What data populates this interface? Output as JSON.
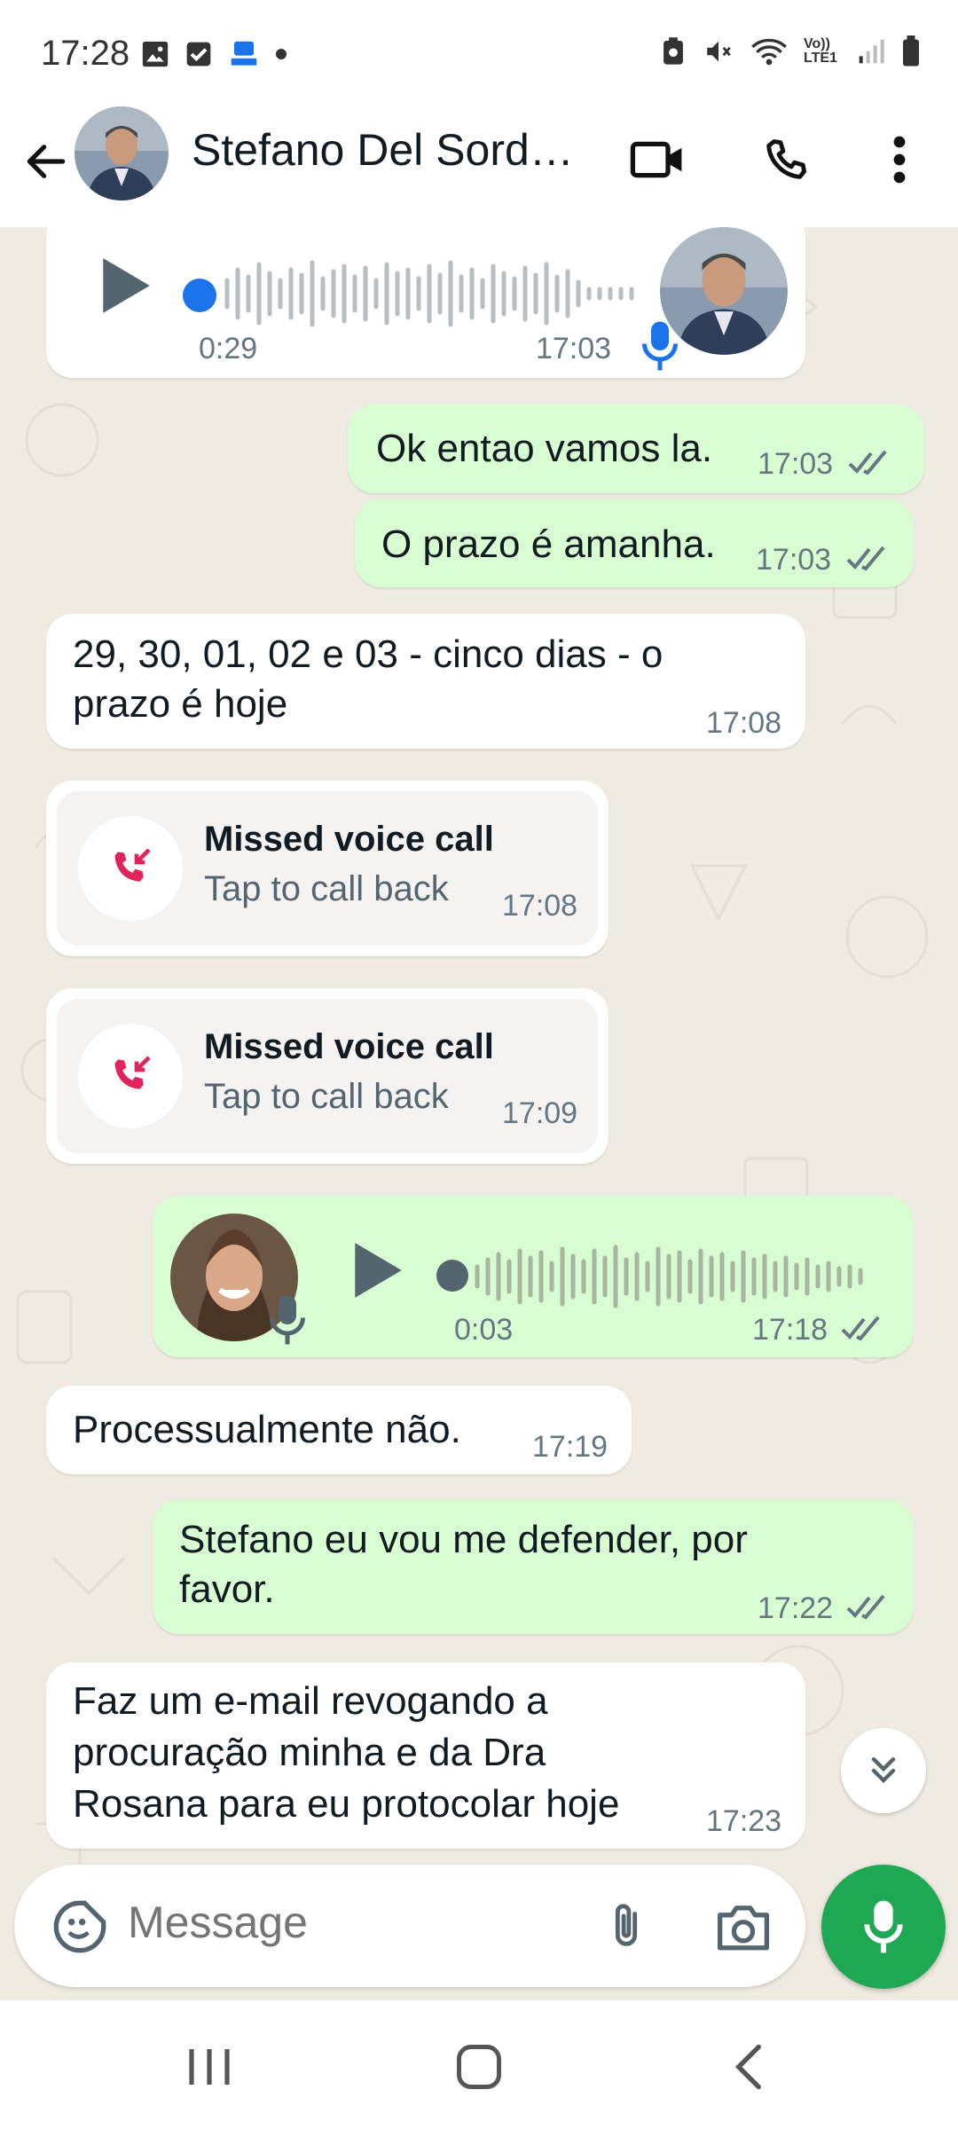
{
  "status_bar": {
    "time": "17:28",
    "network_label": "Vo)) LTE1"
  },
  "header": {
    "contact_name": "Stefano Del Sordo..."
  },
  "messages": {
    "m0": {
      "duration": "0:29",
      "time": "17:03"
    },
    "m1": {
      "text": "Ok entao vamos la.",
      "time": "17:03"
    },
    "m2": {
      "text": "O prazo é amanha.",
      "time": "17:03"
    },
    "m3": {
      "line1": "29, 30, 01, 02 e 03 - cinco dias - o",
      "line2": "prazo é hoje",
      "time": "17:08"
    },
    "m4": {
      "title": "Missed voice call",
      "subtitle": "Tap to call back",
      "time": "17:08"
    },
    "m5": {
      "title": "Missed voice call",
      "subtitle": "Tap to call back",
      "time": "17:09"
    },
    "m6": {
      "duration": "0:03",
      "time": "17:18"
    },
    "m7": {
      "text": "Processualmente não.",
      "time": "17:19"
    },
    "m8": {
      "line1": "Stefano eu vou me defender, por",
      "line2": "favor.",
      "time": "17:22"
    },
    "m9": {
      "line1": "Faz um e-mail revogando a",
      "line2": "procuração minha e da Dra",
      "line3": "Rosana para eu protocolar hoje",
      "time": "17:23"
    }
  },
  "composer": {
    "placeholder": "Message"
  },
  "colors": {
    "accent": "#1da851",
    "outgoing_bubble": "#d9fdd3",
    "incoming_bubble": "#ffffff",
    "chat_bg": "#efeae2",
    "read_tick": "#667781",
    "missed_call": "#e0245e",
    "mic_blue": "#1a73e8"
  }
}
